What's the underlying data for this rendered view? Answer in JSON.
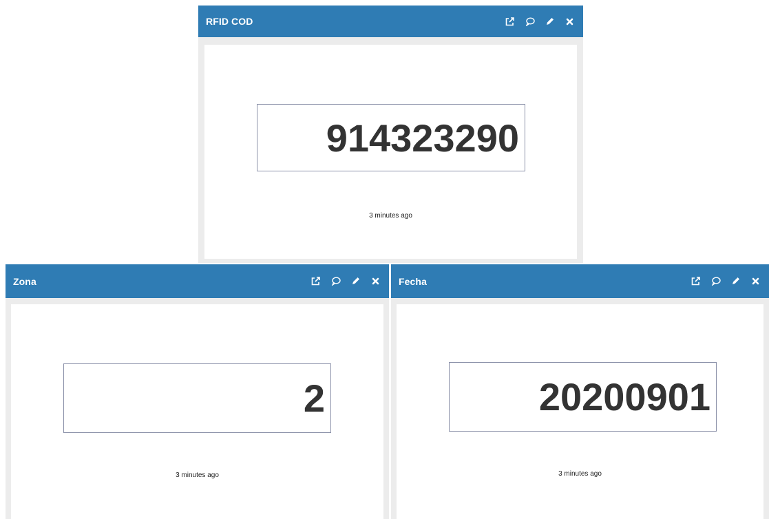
{
  "colors": {
    "header": "#2f7cb4",
    "header_text": "#ffffff",
    "frame": "#ececec",
    "value_text": "#333333",
    "value_border": "#8a90a8"
  },
  "widget_icons": [
    "external-link-icon",
    "comment-icon",
    "edit-pencil-icon",
    "close-icon"
  ],
  "widgets": [
    {
      "title": "RFID COD",
      "value": "914323290",
      "updated": "3 minutes ago"
    },
    {
      "title": "Zona",
      "value": "2",
      "updated": "3 minutes ago"
    },
    {
      "title": "Fecha",
      "value": "20200901",
      "updated": "3 minutes ago"
    }
  ]
}
